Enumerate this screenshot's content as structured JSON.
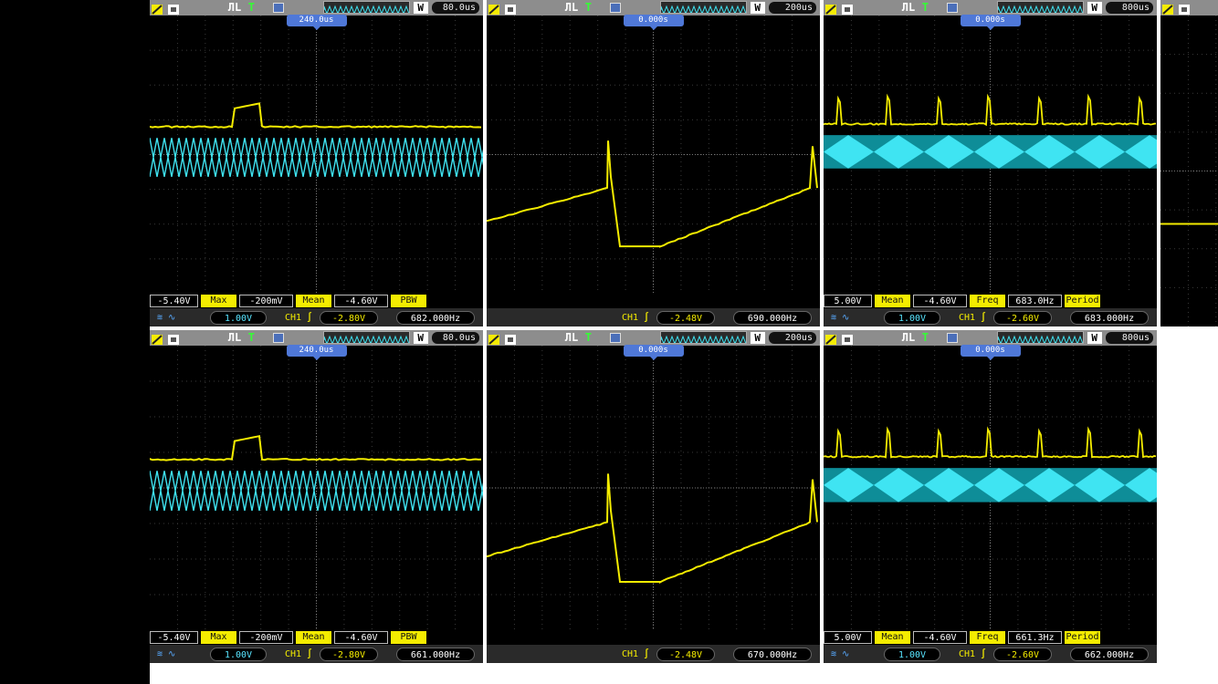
{
  "colors": {
    "ch1": "#f4ec00",
    "ch2": "#3fe4f2",
    "toolbar": "#8d8d8d",
    "marker": "#4f78d8",
    "measure_label_bg": "#f4ec00",
    "statusbar": "#2a2a2a"
  },
  "icons": {
    "run": "pulse-icon",
    "trigger": "trigger-t-icon",
    "save": "save-icon",
    "waveform": "waveform-window-icon",
    "edge": "rising-edge-icon",
    "menu": "menu-icon"
  },
  "toolbar_labels": {
    "w": "W",
    "run": "ЛL",
    "trigger": "T"
  },
  "panels": [
    {
      "id": "r1c1",
      "timebase": "80.0us",
      "marker": "240.0us",
      "measurements": [
        {
          "kind": "val",
          "text": "-5.40V"
        },
        {
          "kind": "lbl",
          "text": "Max"
        },
        {
          "kind": "val",
          "text": "-200mV"
        },
        {
          "kind": "lbl",
          "text": "Mean"
        },
        {
          "kind": "val",
          "text": "-4.60V"
        },
        {
          "kind": "lbl",
          "text": "PBW"
        }
      ],
      "status": {
        "ch2_scale": "1.00V",
        "ch_label": "CH1",
        "trigger_level": "-2.80V",
        "frequency": "682.000Hz",
        "show_ch2": true
      },
      "wave": "square_tri"
    },
    {
      "id": "r1c2",
      "timebase": "200us",
      "marker": "0.000s",
      "measurements": [],
      "status": {
        "ch2_scale": "",
        "ch_label": "CH1",
        "trigger_level": "-2.48V",
        "frequency": "690.000Hz",
        "show_ch2": false
      },
      "wave": "sawtooth"
    },
    {
      "id": "r1c3",
      "timebase": "800us",
      "marker": "0.000s",
      "measurements": [
        {
          "kind": "val",
          "text": "5.00V"
        },
        {
          "kind": "lbl",
          "text": "Mean"
        },
        {
          "kind": "val",
          "text": "-4.60V"
        },
        {
          "kind": "lbl",
          "text": "Freq"
        },
        {
          "kind": "val",
          "text": "683.0Hz"
        },
        {
          "kind": "lbl",
          "text": "Period"
        }
      ],
      "status": {
        "ch2_scale": "1.00V",
        "ch_label": "CH1",
        "trigger_level": "-2.60V",
        "frequency": "683.000Hz",
        "show_ch2": true
      },
      "wave": "spikes_band"
    },
    {
      "id": "r1c4",
      "timebase": "",
      "marker": "",
      "measurements": [],
      "status": null,
      "wave": "flat"
    },
    {
      "id": "r2c1",
      "timebase": "80.0us",
      "marker": "240.0us",
      "measurements": [
        {
          "kind": "val",
          "text": "-5.40V"
        },
        {
          "kind": "lbl",
          "text": "Max"
        },
        {
          "kind": "val",
          "text": "-200mV"
        },
        {
          "kind": "lbl",
          "text": "Mean"
        },
        {
          "kind": "val",
          "text": "-4.60V"
        },
        {
          "kind": "lbl",
          "text": "PBW"
        }
      ],
      "status": {
        "ch2_scale": "1.00V",
        "ch_label": "CH1",
        "trigger_level": "-2.80V",
        "frequency": "661.000Hz",
        "show_ch2": true
      },
      "wave": "square_tri"
    },
    {
      "id": "r2c2",
      "timebase": "200us",
      "marker": "0.000s",
      "measurements": [],
      "status": {
        "ch2_scale": "",
        "ch_label": "CH1",
        "trigger_level": "-2.48V",
        "frequency": "670.000Hz",
        "show_ch2": false
      },
      "wave": "sawtooth"
    },
    {
      "id": "r2c3",
      "timebase": "800us",
      "marker": "0.000s",
      "measurements": [
        {
          "kind": "val",
          "text": "5.00V"
        },
        {
          "kind": "lbl",
          "text": "Mean"
        },
        {
          "kind": "val",
          "text": "-4.60V"
        },
        {
          "kind": "lbl",
          "text": "Freq"
        },
        {
          "kind": "val",
          "text": "661.3Hz"
        },
        {
          "kind": "lbl",
          "text": "Period"
        }
      ],
      "status": {
        "ch2_scale": "1.00V",
        "ch_label": "CH1",
        "trigger_level": "-2.60V",
        "frequency": "662.000Hz",
        "show_ch2": true
      },
      "wave": "spikes_band"
    }
  ]
}
